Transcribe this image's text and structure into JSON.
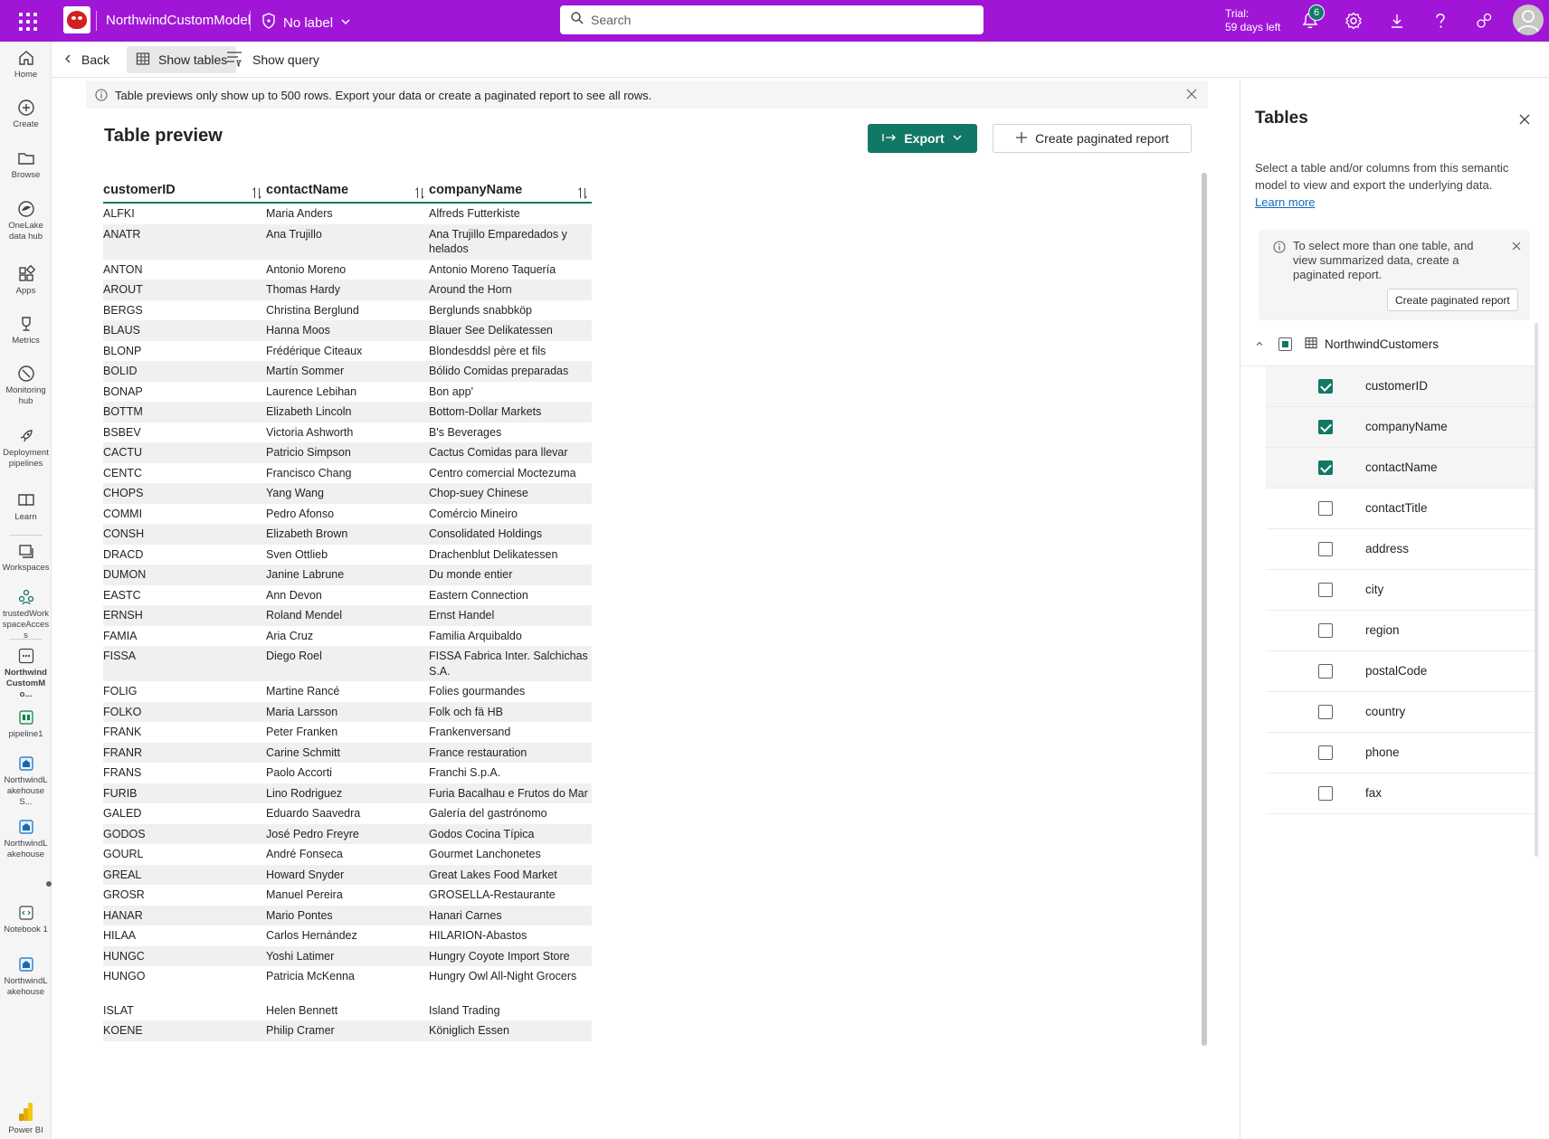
{
  "topbar": {
    "title": "NorthwindCustomModel",
    "sensitivity_label": "No label",
    "search_placeholder": "Search",
    "trial_line1": "Trial:",
    "trial_line2": "59 days left",
    "notification_count": "6",
    "accent_color": "#a116d6"
  },
  "leftnav": {
    "items": [
      {
        "label": "Home",
        "icon": "home-icon"
      },
      {
        "label": "Create",
        "icon": "plus-circle-icon"
      },
      {
        "label": "Browse",
        "icon": "folder-icon"
      },
      {
        "label": "OneLake data hub",
        "icon": "onelake-icon"
      },
      {
        "label": "Apps",
        "icon": "apps-icon"
      },
      {
        "label": "Metrics",
        "icon": "trophy-icon"
      },
      {
        "label": "Monitoring hub",
        "icon": "monitoring-icon"
      },
      {
        "label": "Deployment pipelines",
        "icon": "rocket-icon"
      },
      {
        "label": "Learn",
        "icon": "book-icon"
      },
      {
        "label": "Workspaces",
        "icon": "workspaces-icon"
      },
      {
        "label": "trustedWorkspaceAccess",
        "icon": "workspace-people-icon"
      },
      {
        "label": "NorthwindCustomMo...",
        "icon": "semantic-model-icon"
      },
      {
        "label": "pipeline1",
        "icon": "pipeline-icon"
      },
      {
        "label": "NorthwindLakehouseS...",
        "icon": "lakehouse-icon"
      },
      {
        "label": "NorthwindLakehouse",
        "icon": "lakehouse-icon"
      },
      {
        "label": "Notebook 1",
        "icon": "notebook-icon"
      },
      {
        "label": "NorthwindLakehouse",
        "icon": "lakehouse-icon"
      },
      {
        "label": "Power BI",
        "icon": "powerbi-icon"
      }
    ]
  },
  "cmdbar": {
    "back": "Back",
    "show_tables": "Show tables",
    "show_query": "Show query"
  },
  "main": {
    "info_message": "Table previews only show up to 500 rows. Export your data or create a paginated report to see all rows.",
    "title": "Table preview",
    "export_label": "Export",
    "create_report_label": "Create paginated report",
    "columns": [
      "customerID",
      "contactName",
      "companyName"
    ],
    "rows": [
      [
        "ALFKI",
        "Maria Anders",
        "Alfreds Futterkiste"
      ],
      [
        "ANATR",
        "Ana Trujillo",
        "Ana Trujillo Emparedados y helados"
      ],
      [
        "ANTON",
        "Antonio Moreno",
        "Antonio Moreno Taquería"
      ],
      [
        "AROUT",
        "Thomas Hardy",
        "Around the Horn"
      ],
      [
        "BERGS",
        "Christina Berglund",
        "Berglunds snabbköp"
      ],
      [
        "BLAUS",
        "Hanna Moos",
        "Blauer See Delikatessen"
      ],
      [
        "BLONP",
        "Frédérique Citeaux",
        "Blondesddsl père et fils"
      ],
      [
        "BOLID",
        "Martín Sommer",
        "Bólido Comidas preparadas"
      ],
      [
        "BONAP",
        "Laurence Lebihan",
        "Bon app'"
      ],
      [
        "BOTTM",
        "Elizabeth Lincoln",
        "Bottom-Dollar Markets"
      ],
      [
        "BSBEV",
        "Victoria Ashworth",
        "B's Beverages"
      ],
      [
        "CACTU",
        "Patricio Simpson",
        "Cactus Comidas para llevar"
      ],
      [
        "CENTC",
        "Francisco Chang",
        "Centro comercial Moctezuma"
      ],
      [
        "CHOPS",
        "Yang Wang",
        "Chop-suey Chinese"
      ],
      [
        "COMMI",
        "Pedro Afonso",
        "Comércio Mineiro"
      ],
      [
        "CONSH",
        "Elizabeth Brown",
        "Consolidated Holdings"
      ],
      [
        "DRACD",
        "Sven Ottlieb",
        "Drachenblut Delikatessen"
      ],
      [
        "DUMON",
        "Janine Labrune",
        "Du monde entier"
      ],
      [
        "EASTC",
        "Ann Devon",
        "Eastern Connection"
      ],
      [
        "ERNSH",
        "Roland Mendel",
        "Ernst Handel"
      ],
      [
        "FAMIA",
        "Aria Cruz",
        "Familia Arquibaldo"
      ],
      [
        "FISSA",
        "Diego Roel",
        "FISSA Fabrica Inter. Salchichas S.A."
      ],
      [
        "FOLIG",
        "Martine Rancé",
        "Folies gourmandes"
      ],
      [
        "FOLKO",
        "Maria Larsson",
        "Folk och fä HB"
      ],
      [
        "FRANK",
        "Peter Franken",
        "Frankenversand"
      ],
      [
        "FRANR",
        "Carine Schmitt",
        "France restauration"
      ],
      [
        "FRANS",
        "Paolo Accorti",
        "Franchi S.p.A."
      ],
      [
        "FURIB",
        "Lino Rodriguez",
        "Furia Bacalhau e Frutos do Mar"
      ],
      [
        "GALED",
        "Eduardo Saavedra",
        "Galería del gastrónomo"
      ],
      [
        "GODOS",
        "José Pedro Freyre",
        "Godos Cocina Típica"
      ],
      [
        "GOURL",
        "André Fonseca",
        "Gourmet Lanchonetes"
      ],
      [
        "GREAL",
        "Howard Snyder",
        "Great Lakes Food Market"
      ],
      [
        "GROSR",
        "Manuel Pereira",
        "GROSELLA-Restaurante"
      ],
      [
        "HANAR",
        "Mario Pontes",
        "Hanari Carnes"
      ],
      [
        "HILAA",
        "Carlos Hernández",
        "HILARION-Abastos"
      ],
      [
        "HUNGC",
        "Yoshi Latimer",
        "Hungry Coyote Import Store"
      ],
      [
        "HUNGO",
        "Patricia McKenna",
        "Hungry Owl All-Night Grocers"
      ],
      [
        "ISLAT",
        "Helen Bennett",
        "Island Trading"
      ],
      [
        "KOENE",
        "Philip Cramer",
        "Königlich Essen"
      ]
    ]
  },
  "panel": {
    "title": "Tables",
    "description": "Select a table and/or columns from this semantic model to view and export the underlying data.",
    "learn_more": "Learn more",
    "note": "To select more than one table, and view summarized data, create a paginated report.",
    "note_button": "Create paginated report",
    "table_name": "NorthwindCustomers",
    "columns": [
      {
        "name": "customerID",
        "checked": true
      },
      {
        "name": "companyName",
        "checked": true
      },
      {
        "name": "contactName",
        "checked": true
      },
      {
        "name": "contactTitle",
        "checked": false
      },
      {
        "name": "address",
        "checked": false
      },
      {
        "name": "city",
        "checked": false
      },
      {
        "name": "region",
        "checked": false
      },
      {
        "name": "postalCode",
        "checked": false
      },
      {
        "name": "country",
        "checked": false
      },
      {
        "name": "phone",
        "checked": false
      },
      {
        "name": "fax",
        "checked": false
      }
    ]
  }
}
